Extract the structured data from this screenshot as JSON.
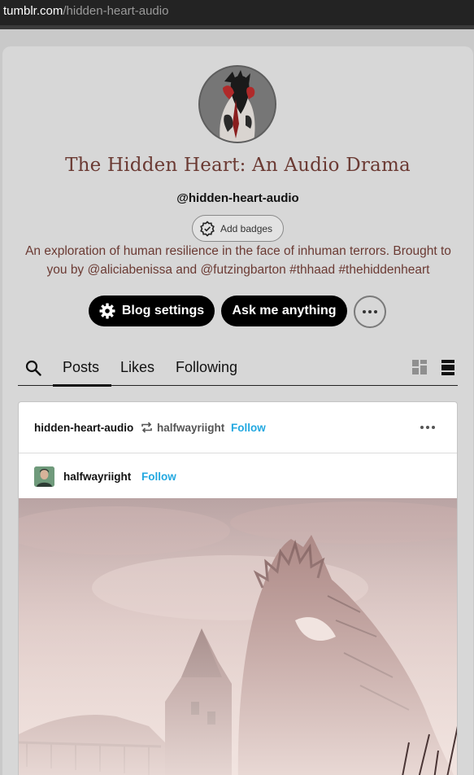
{
  "browser": {
    "url_host": "tumblr.com",
    "url_path": "/hidden-heart-audio"
  },
  "blog": {
    "title": "The Hidden Heart: An Audio Drama",
    "handle": "@hidden-heart-audio",
    "badges_label": "Add badges",
    "description": "An exploration of human resilience in the face of inhuman terrors. Brought to you by @aliciabenissa and @futzingbarton #thhaad #thehiddenheart"
  },
  "actions": {
    "settings_label": "Blog settings",
    "ask_label": "Ask me anything"
  },
  "tabs": [
    {
      "label": "Posts",
      "active": true
    },
    {
      "label": "Likes",
      "active": false
    },
    {
      "label": "Following",
      "active": false
    }
  ],
  "post": {
    "author": "hidden-heart-audio",
    "reblogged_from": "halfwayriight",
    "follow_label": "Follow",
    "reblog_user": "halfwayriight",
    "reblog_follow_label": "Follow"
  },
  "colors": {
    "title": "#6b3a33",
    "follow": "#22a8e0",
    "button": "#000000"
  },
  "icons": [
    "search-icon",
    "gear-icon",
    "badge-icon",
    "more-icon",
    "grid-view-icon",
    "list-view-icon",
    "reblog-icon"
  ]
}
